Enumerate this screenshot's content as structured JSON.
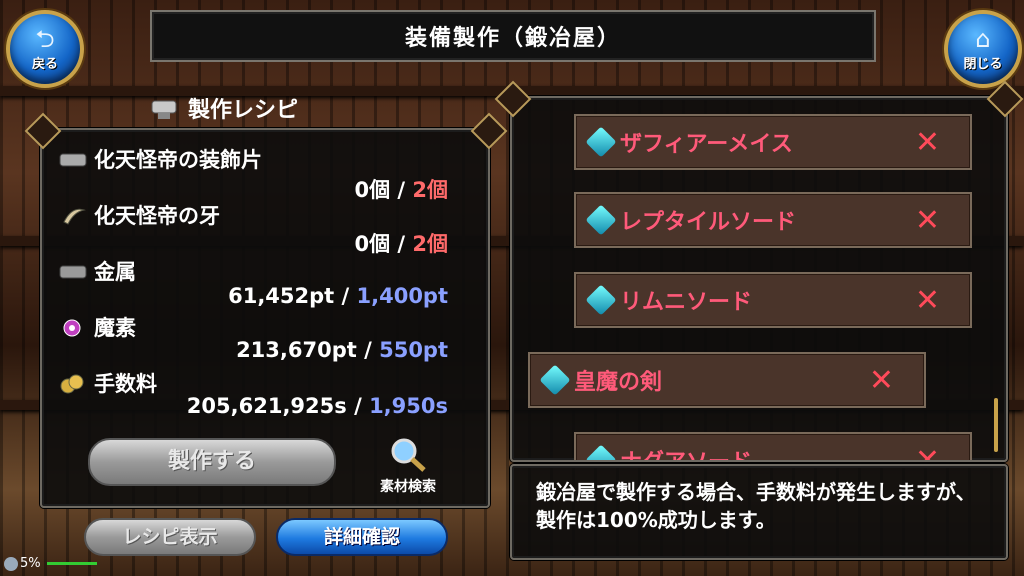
{
  "header": {
    "title": "装備製作（鍛冶屋）",
    "back_label": "戻る",
    "close_label": "閉じる"
  },
  "recipe": {
    "header_label": "製作レシピ",
    "materials": [
      {
        "name": "化天怪帝の装飾片",
        "have": "0個",
        "sep": "/",
        "need": "2個",
        "need_color": "red",
        "icon": "ingot-icon"
      },
      {
        "name": "化天怪帝の牙",
        "have": "0個",
        "sep": "/",
        "need": "2個",
        "need_color": "red",
        "icon": "fang-icon"
      },
      {
        "name": "金属",
        "have": "61,452pt",
        "sep": "/",
        "need": "1,400pt",
        "need_color": "blue",
        "icon": "metal-icon"
      },
      {
        "name": "魔素",
        "have": "213,670pt",
        "sep": "/",
        "need": "550pt",
        "need_color": "blue",
        "icon": "magic-orb-icon"
      },
      {
        "name": "手数料",
        "have": "205,621,925s",
        "sep": "/",
        "need": "1,950s",
        "need_color": "blue",
        "icon": "coins-icon"
      }
    ],
    "craft_button": "製作する",
    "material_search_label": "素材検索"
  },
  "bottom_buttons": {
    "recipe_display": "レシピ表示",
    "detail_confirm": "詳細確認"
  },
  "status": {
    "percent": "5%"
  },
  "items": [
    {
      "name": "ザフィアーメイス",
      "mark": "✕"
    },
    {
      "name": "レプタイルソード",
      "mark": "✕"
    },
    {
      "name": "リムニソード",
      "mark": "✕"
    },
    {
      "name": "皇魔の剣",
      "mark": "✕",
      "selected": true
    },
    {
      "name": "ナグアソード",
      "mark": "✕"
    }
  ],
  "message": "鍛冶屋で製作する場合、手数料が発生しますが、製作は100%成功します。",
  "colors": {
    "need_red": "#ff6a6a",
    "need_blue": "#8aa0ff",
    "item_name": "#ff5a7a"
  }
}
